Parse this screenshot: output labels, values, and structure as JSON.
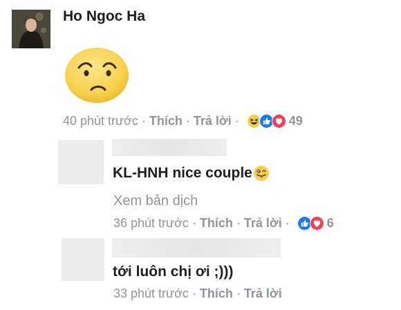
{
  "comment": {
    "author": "Ho Ngoc Ha",
    "time": "40 phút trước",
    "like_label": "Thích",
    "reply_label": "Trả lời",
    "reaction_icons": [
      "laugh-icon",
      "like-icon",
      "love-icon"
    ],
    "reaction_count": "49"
  },
  "replies": [
    {
      "text": "KL-HNH nice couple",
      "translate_label": "Xem bản dịch",
      "time": "36 phút trước",
      "like_label": "Thích",
      "reply_label": "Trả lời",
      "reaction_icons": [
        "like-icon",
        "love-icon"
      ],
      "reaction_count": "6"
    },
    {
      "text": "tới luôn chị ơi ;)))",
      "time": "33 phút trước",
      "like_label": "Thích",
      "reply_label": "Trả lời"
    }
  ],
  "separator": "·",
  "colors": {
    "meta_text": "#90949c",
    "like_blue": "#1877f2",
    "love_red": "#f33e58",
    "emoji_yellow": "#f7d04a"
  }
}
